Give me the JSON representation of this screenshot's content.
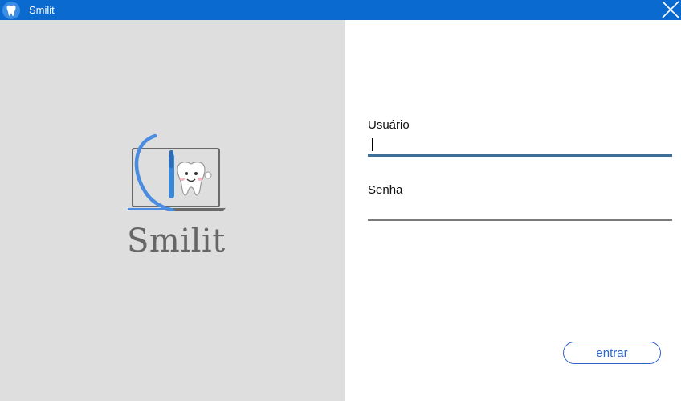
{
  "window": {
    "title": "Smilit",
    "app_icon": "tooth-icon",
    "close_icon": "close-icon",
    "titlebar_color": "#0a6ad0"
  },
  "branding": {
    "logo_icon": "laptop-tooth-toothbrush-logo",
    "name": "Smilit"
  },
  "login": {
    "username_label": "Usuário",
    "username_value": "",
    "password_label": "Senha",
    "password_value": "",
    "submit_label": "entrar",
    "accent_color": "#2f64c8",
    "active_underline_color": "#3d6f99",
    "inactive_underline_color": "#7a7a7a"
  }
}
